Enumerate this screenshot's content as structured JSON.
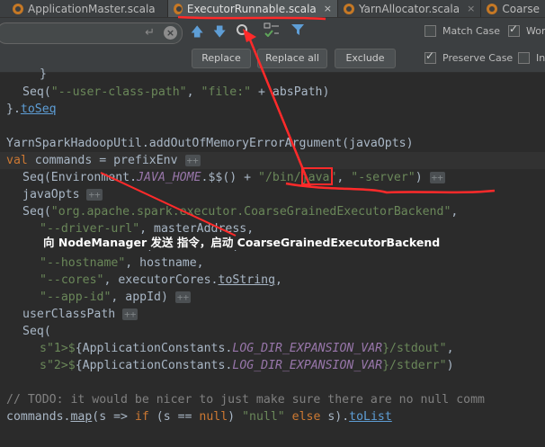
{
  "tabs": [
    {
      "label": "ApplicationMaster.scala",
      "active": false
    },
    {
      "label": "ExecutorRunnable.scala",
      "active": true
    },
    {
      "label": "YarnAllocator.scala",
      "active": false
    },
    {
      "label": "Coarse",
      "active": false
    }
  ],
  "tab_close_glyph": "×",
  "find": {
    "search_value": "",
    "enter_glyph": "↵",
    "clear_glyph": "×",
    "match_case": "Match Case",
    "words": "Wor",
    "preserve_case": "Preserve Case",
    "in_selection": "In",
    "replace": "Replace",
    "replace_all": "Replace all",
    "exclude": "Exclude"
  },
  "toolbar_icons": [
    "arrow-up-icon",
    "arrow-down-icon",
    "find-word-icon",
    "filter-options-icon",
    "filter-icon"
  ],
  "chip": "++",
  "code": {
    "l1": "}",
    "l2a": "Seq(",
    "l2b": "\"--user-class-path\"",
    "l2c": ", ",
    "l2d": "\"file:\"",
    "l2e": " + absPath)",
    "l3a": "}.",
    "l3b": "toSeq",
    "l5": "YarnSparkHadoopUtil.addOutOfMemoryErrorArgument(javaOpts)",
    "l6a": "val",
    "l6b": " commands = prefixEnv ",
    "l7a": "Seq(Environment.",
    "l7b": "JAVA_HOME",
    "l7c": ".$$() + ",
    "l7d": "\"/bin/java\"",
    "l7e": ", ",
    "l7f": "\"-server\"",
    "l7g": ") ",
    "l8": "javaOpts ",
    "l9a": "Seq(",
    "l9b": "\"org.apache.spark.executor.CoarseGrainedExecutorBackend\"",
    "l9c": ",",
    "l10a": "\"--driver-url\"",
    "l10b": ", masterAddress,",
    "l11a": "\"--executor-id\"",
    "l11b": ", executorId,",
    "l12a": "\"--hostname\"",
    "l12b": ", hostname,",
    "l13a": "\"--cores\"",
    "l13b": ", executorCores.",
    "l13c": "toString",
    "l13d": ",",
    "l14a": "\"--app-id\"",
    "l14b": ", appId) ",
    "l15": "userClassPath ",
    "l16": "Seq(",
    "l17a": "s\"1>$",
    "l17b": "{ApplicationConstants.",
    "l17c": "LOG_DIR_EXPANSION_VAR",
    "l17d": "}/stdout\"",
    "l17e": ",",
    "l18a": "s\"2>$",
    "l18b": "{ApplicationConstants.",
    "l18c": "LOG_DIR_EXPANSION_VAR",
    "l18d": "}/stderr\"",
    "l18e": ")",
    "l20": "// TODO: it would be nicer to just make sure there are no null comm",
    "l21a": "commands.",
    "l21b": "map",
    "l21c": "(s => ",
    "l21d": "if",
    "l21e": " (s == ",
    "l21f": "null",
    "l21g": ") ",
    "l21h": "\"null\"",
    "l21i": " else",
    "l21j": " s).",
    "l21k": "toList"
  },
  "annotation": "向 NodeManager 发送 指令，启动 CoarseGrainedExecutorBackend",
  "annotation_color": "#ff2a2a"
}
